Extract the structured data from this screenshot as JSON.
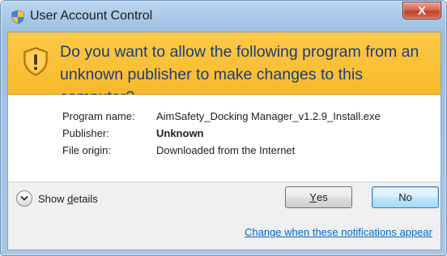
{
  "window": {
    "title": "User Account Control",
    "close_label": "X"
  },
  "banner": {
    "question": "Do you want to allow the following program from an unknown publisher to make changes to this computer?"
  },
  "info": {
    "program_label": "Program name:",
    "program_value": "AimSafety_Docking Manager_v1.2.9_Install.exe",
    "publisher_label": "Publisher:",
    "publisher_value": "Unknown",
    "origin_label": "File origin:",
    "origin_value": "Downloaded from the Internet"
  },
  "footer": {
    "details_prefix": "Show ",
    "details_underlined": "d",
    "details_suffix": "etails",
    "yes_prefix": "",
    "yes_underlined": "Y",
    "yes_suffix": "es",
    "no_label": "No",
    "notify_link": "Change when these notifications appear"
  },
  "colors": {
    "banner": "#f8b92b",
    "banner_text": "#1a3e7a",
    "link": "#0066cc",
    "title_bar": "#aac8e7"
  },
  "icons": {
    "title": "uac-shield-icon",
    "banner": "warning-shield-icon",
    "details": "chevron-down-icon"
  }
}
